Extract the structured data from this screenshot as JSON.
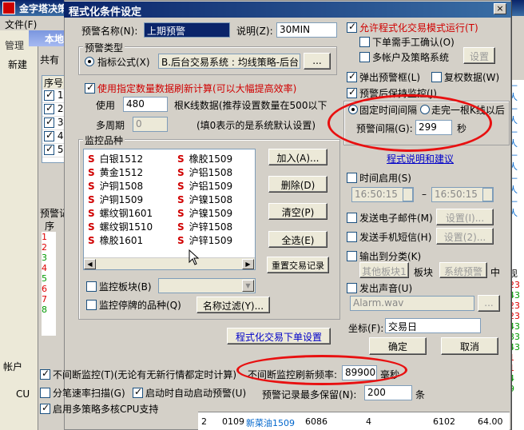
{
  "bg": {
    "app_title": "金字塔决策",
    "menu_file": "文件(F)",
    "tab_manage": "管理",
    "tab_new": "新建",
    "inner_title": "本地",
    "share_label": "共有",
    "seq_header": "序号",
    "rows": [
      "1",
      "2",
      "3",
      "4",
      "5"
    ],
    "alert_label": "预警记",
    "seq2": "序",
    "right_col": [
      "—人",
      "—人",
      "—人",
      "—人",
      "—人",
      "—人",
      "现",
      "23",
      "43",
      "23",
      "23",
      "43",
      "33",
      "43",
      "1",
      "1",
      "4",
      "9"
    ],
    "account_label": "帐户",
    "cu_label": "CU",
    "bottom_row": {
      "c1": "2",
      "c2": "0109",
      "c3": "新菜油1509",
      "c4": "6086",
      "c5": "4",
      "c6": "6102",
      "c7": "64.00"
    },
    "left_data": [
      "1",
      "2",
      "3",
      "4",
      "5",
      "6",
      "7",
      "8",
      "9"
    ]
  },
  "dialog": {
    "title": "程式化条件设定",
    "close": "×",
    "alert_name_label": "预警名称(N):",
    "alert_name_value": "上期预警",
    "desc_label": "说明(Z):",
    "desc_value": "30MIN",
    "alert_type_group": "预警类型",
    "indicator_label": "指标公式(X)",
    "indicator_value": "B.后台交易系统 : 均线策略-后台",
    "indicator_btn": "...",
    "use_count_label": "使用指定数量数据刷新计算(可以大幅提高效率)",
    "use_label": "使用",
    "use_value": "480",
    "kline_label": "根K线数据(推荐设置数量在500以下",
    "multi_period_label": "多周期",
    "multi_period_value": "0",
    "zero_note": "(填0表示的是系统默认设置)",
    "monitor_group": "监控品种",
    "monitor_items_left": [
      "白银1512",
      "黄金1512",
      "沪铜1508",
      "沪铜1509",
      "螺纹钢1601",
      "螺纹钢1510",
      "橡胶1601"
    ],
    "monitor_items_right": [
      "橡胶1509",
      "沪铝1508",
      "沪铝1509",
      "沪镍1508",
      "沪镍1509",
      "沪锌1508",
      "沪锌1509"
    ],
    "s_mark": "S",
    "btn_add": "加入(A)...",
    "btn_delete": "删除(D)",
    "btn_clear": "清空(P)",
    "btn_select_all": "全选(E)",
    "btn_reset_record": "重置交易记录",
    "monitor_block_label": "监控板块(B)",
    "monitor_stopped_label": "监控停牌的品种(Q)",
    "name_filter_btn": "名称过滤(Y)...",
    "program_order_btn": "程式化交易下单设置",
    "allow_program_label": "允许程式化交易模式运行(T)",
    "manual_confirm_label": "下单需手工确认(O)",
    "multi_account_label": "多帐户及策略系统",
    "multi_account_btn": "设置",
    "popup_label": "弹出预警框(L)",
    "review_label": "复权数据(W)",
    "keep_monitor_label": "预警后保持监控(J)",
    "fixed_interval_label": "固定时间间隔",
    "kline_finish_label": "走完一根K线以后",
    "interval_label": "预警间隔(G):",
    "interval_value": "299",
    "interval_unit": "秒",
    "program_help_link": "程式说明和建议",
    "time_enable_label": "时间启用(S)",
    "time_from": "16:50:15",
    "time_dash": "–",
    "time_to": "16:50:15",
    "email_label": "发送电子邮件(M)",
    "email_btn": "设置(I)...",
    "sms_label": "发送手机短信(H)",
    "sms_btn": "设置(2)...",
    "output_category_label": "输出到分类(K)",
    "other_block_label": "其他板块1",
    "block_label": "板块",
    "system_alert_label": "系统预警",
    "mid_label": "中",
    "sound_label": "发出声音(U)",
    "sound_file": "Alarm.wav",
    "sound_btn": "...",
    "coord_label": "坐标(F):",
    "coord_value": "交易日",
    "ok_btn": "确定",
    "cancel_btn": "取消",
    "continuous_label": "不间断监控(T)(无论有无新行情都定时计算)",
    "continuous_freq_label": "不间断监控刷新频率:",
    "continuous_freq_value": "899000",
    "continuous_unit": "毫秒",
    "tick_scan_label": "分笔速率扫描(G)",
    "auto_start_label": "启动时自动启动预警(U)",
    "alert_record_label": "预警记录最多保留(N):",
    "alert_record_value": "200",
    "alert_record_unit": "条",
    "multicore_label": "启用多策略多核CPU支持"
  }
}
